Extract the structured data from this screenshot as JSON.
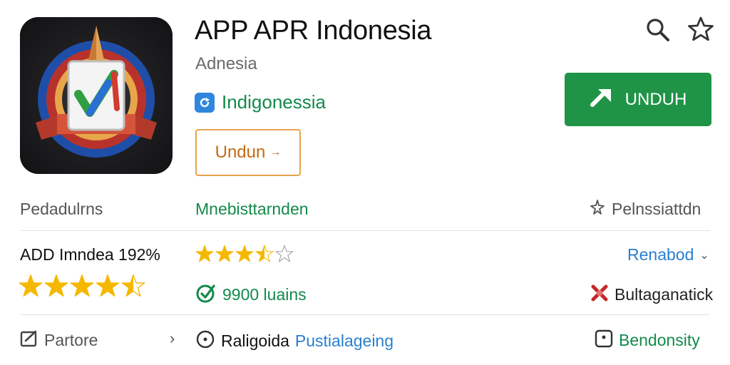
{
  "app": {
    "title": "APP APR Indonesia",
    "developer": "Adnesia",
    "category": "Indigonessia",
    "secondary_button": "Undun",
    "install_button": "UNDUH"
  },
  "icon_names": {
    "search": "search-icon",
    "favorite": "star-outline-icon",
    "install": "download-arrow-icon",
    "category": "refresh-badge-icon"
  },
  "colors": {
    "install_bg": "#1f9447",
    "accent_green": "#138a4a",
    "accent_orange": "#e6a350",
    "link_blue": "#2a7fd0",
    "star_gold": "#f5b800"
  },
  "row1": {
    "left": "Pedadulrns",
    "center": "Mnebisttarnden",
    "right": "Pelnssiattdn"
  },
  "row2": {
    "rating_label": "ADD Imndea 192%",
    "rating_value": 4.5,
    "rating_max": 5,
    "center_rating": 3.5,
    "center_text": "9900 luains",
    "right_link": "Renabod",
    "right_text": "Bultaganatick"
  },
  "row3": {
    "left": "Partore",
    "center_a": "Raligoida",
    "center_b": "Pustialageing",
    "right": "Bendonsity"
  }
}
